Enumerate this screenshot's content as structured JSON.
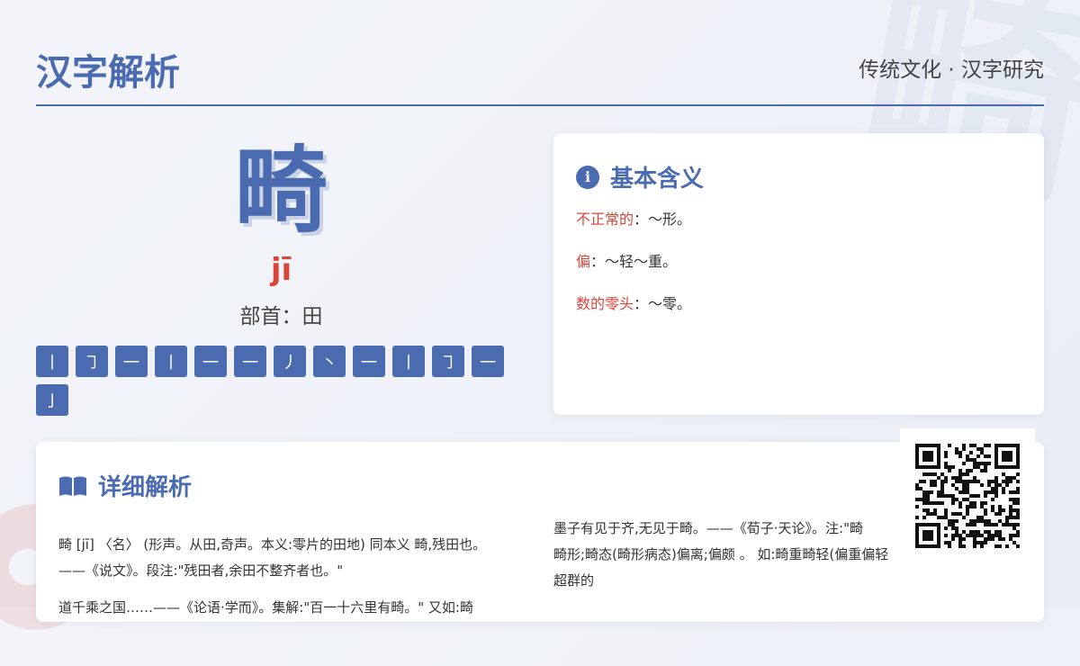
{
  "header": {
    "title": "汉字解析",
    "subtitle": "传统文化 · 汉字研究"
  },
  "watermark": "畸",
  "character": {
    "glyph": "畸",
    "pinyin": "jī",
    "radical": "部首：田",
    "strokes": [
      "丨",
      "㇆",
      "一",
      "丨",
      "一",
      "一",
      "丿",
      "丶",
      "一",
      "丨",
      "㇆",
      "一",
      "亅"
    ]
  },
  "meaning": {
    "heading": "基本含义",
    "icon": "info-icon",
    "items": [
      {
        "term": "不正常的",
        "text": "：～形。"
      },
      {
        "term": "偏",
        "text": "：～轻～重。"
      },
      {
        "term": "数的零头",
        "text": "：～零。"
      }
    ]
  },
  "detail": {
    "heading": "详细解析",
    "icon": "book-icon",
    "col1": [
      "畸 [jī] 〈名〉 (形声。从田,奇声。本义:零片的田地) 同本义 畸,残田也。",
      "——《说文》。段注:\"残田者,余田不整齐者也。\"",
      "",
      "道千乘之国……——《论语·学而》。集解:\"百一十六里有畸。\" 又如:畸"
    ],
    "col2": [
      "墨子有见于齐,无见于畸。——《荀子·天论》。注:\"畸",
      "畸形;畸态(畸形病态)偏离;偏颇 。 如:畸重畸轻(偏重偏轻",
      "超群的"
    ]
  },
  "qr_code": "qr-code-icon",
  "colors": {
    "accent": "#4a6bb0",
    "highlight": "#d9453a"
  }
}
